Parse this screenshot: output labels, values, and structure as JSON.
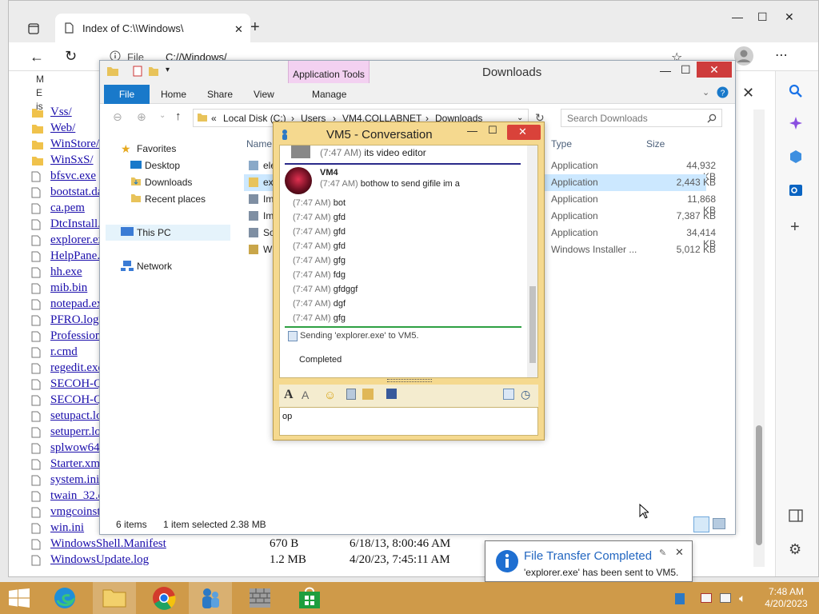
{
  "browser": {
    "tab_title": "Index of C:\\\\Windows\\",
    "url": "C://Windows/",
    "info_label": "File",
    "left_partial": [
      "M",
      "E",
      "is"
    ],
    "listing": [
      {
        "name": "Vss/",
        "folder": true
      },
      {
        "name": "Web/",
        "folder": true
      },
      {
        "name": "WinStore/",
        "folder": true
      },
      {
        "name": "WinSxS/",
        "folder": true
      },
      {
        "name": "bfsvc.exe",
        "folder": false
      },
      {
        "name": "bootstat.dat",
        "folder": false
      },
      {
        "name": "ca.pem",
        "folder": false
      },
      {
        "name": "DtcInstall.log",
        "folder": false
      },
      {
        "name": "explorer.exe",
        "folder": false
      },
      {
        "name": "HelpPane.exe",
        "folder": false
      },
      {
        "name": "hh.exe",
        "folder": false
      },
      {
        "name": "mib.bin",
        "folder": false
      },
      {
        "name": "notepad.exe",
        "folder": false
      },
      {
        "name": "PFRO.log",
        "folder": false
      },
      {
        "name": "Professional.xml",
        "folder": false
      },
      {
        "name": "r.cmd",
        "folder": false
      },
      {
        "name": "regedit.exe",
        "folder": false
      },
      {
        "name": "SECOH-QAD.dll",
        "folder": false
      },
      {
        "name": "SECOH-QAD.exe",
        "folder": false
      },
      {
        "name": "setupact.log",
        "folder": false
      },
      {
        "name": "setuperr.log",
        "folder": false
      },
      {
        "name": "splwow64.exe",
        "folder": false
      },
      {
        "name": "Starter.xml",
        "folder": false
      },
      {
        "name": "system.ini",
        "folder": false
      },
      {
        "name": "twain_32.dll",
        "folder": false
      },
      {
        "name": "vmgcoinstall.log",
        "folder": false
      },
      {
        "name": "win.ini",
        "folder": false
      },
      {
        "name": "WindowsShell.Manifest",
        "folder": false,
        "size": "670 B",
        "date": "6/18/13, 8:00:46 AM"
      },
      {
        "name": "WindowsUpdate.log",
        "folder": false,
        "size": "1.2 MB",
        "date": "4/20/23, 7:45:11 AM"
      }
    ]
  },
  "explorer": {
    "title": "Downloads",
    "context_tab": "Application Tools",
    "tabs": {
      "file": "File",
      "home": "Home",
      "share": "Share",
      "view": "View",
      "manage": "Manage"
    },
    "breadcrumb": {
      "prefix": "«",
      "c1": "Local Disk (C:)",
      "c2": "Users",
      "c3": "VM4.COLLABNET",
      "c4": "Downloads"
    },
    "search_placeholder": "Search Downloads",
    "nav": {
      "favorites": "Favorites",
      "desktop": "Desktop",
      "downloads": "Downloads",
      "recent": "Recent places",
      "thispc": "This PC",
      "network": "Network"
    },
    "columns": {
      "name": "Name",
      "type": "Type",
      "size": "Size"
    },
    "rows": [
      {
        "name": "ele",
        "type": "Application",
        "size": "44,932 KB"
      },
      {
        "name": "exp",
        "type": "Application",
        "size": "2,443 KB"
      },
      {
        "name": "Im",
        "type": "Application",
        "size": "11,868 KB"
      },
      {
        "name": "Im",
        "type": "Application",
        "size": "7,387 KB"
      },
      {
        "name": "So",
        "type": "Application",
        "size": "34,414 KB"
      },
      {
        "name": "Wi",
        "type": "Windows Installer ...",
        "size": "5,012 KB"
      }
    ],
    "status": {
      "items": "6 items",
      "selected": "1 item selected",
      "selsize": "2.38 MB"
    }
  },
  "conversation": {
    "title": "VM5 - Conversation",
    "top_line": {
      "time": "(7:47 AM)",
      "text": "its video editor"
    },
    "sender": "VM4",
    "first_msg": {
      "time": "(7:47 AM)",
      "text": "bothow to send gifile im a"
    },
    "messages": [
      {
        "time": "(7:47 AM)",
        "text": "bot"
      },
      {
        "time": "(7:47 AM)",
        "text": "gfd"
      },
      {
        "time": "(7:47 AM)",
        "text": "gfd"
      },
      {
        "time": "(7:47 AM)",
        "text": "gfd"
      },
      {
        "time": "(7:47 AM)",
        "text": "gfg"
      },
      {
        "time": "(7:47 AM)",
        "text": "fdg"
      },
      {
        "time": "(7:47 AM)",
        "text": "gfdggf"
      },
      {
        "time": "(7:47 AM)",
        "text": "dgf"
      },
      {
        "time": "(7:47 AM)",
        "text": "gfg"
      }
    ],
    "sending": "Sending 'explorer.exe' to VM5.",
    "completed": "Completed",
    "input_value": "op"
  },
  "toast": {
    "title": "File Transfer Completed",
    "body": "'explorer.exe' has been sent to VM5."
  },
  "taskbar": {
    "time": "7:48 AM",
    "date": "4/20/2023"
  },
  "colors": {
    "accent": "#1979ca",
    "taskbar": "#cf9a49",
    "context_tab": "#f3d1f1",
    "conv_frame": "#f5d98f"
  }
}
